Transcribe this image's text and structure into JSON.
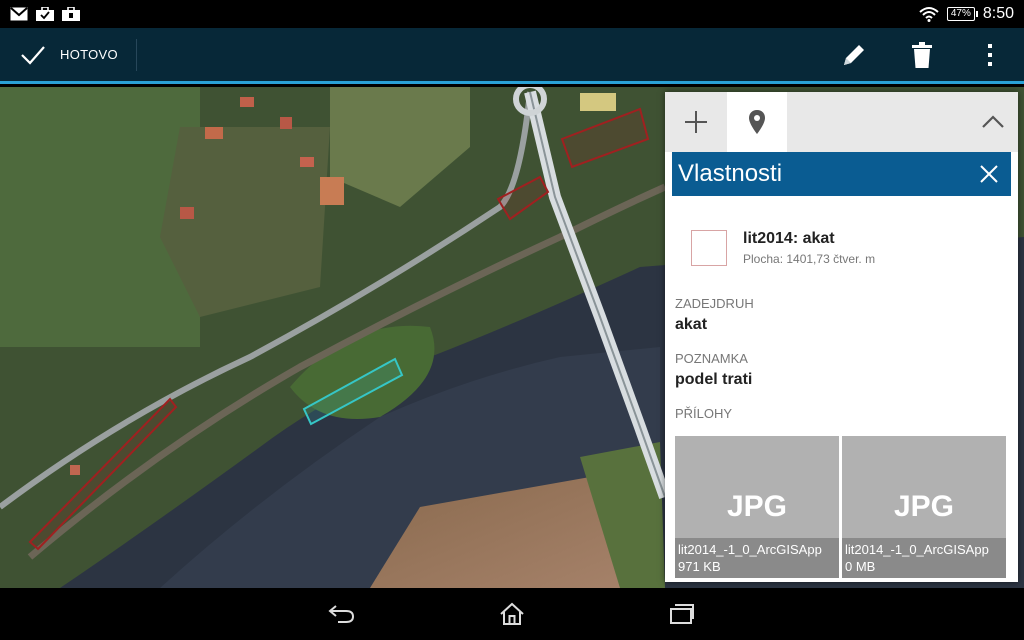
{
  "status_bar": {
    "time": "8:50",
    "battery": "47%",
    "notification_icons": [
      "gmail-icon",
      "briefcase-icon",
      "briefcase-icon"
    ],
    "wifi_icon": "wifi-icon"
  },
  "action_bar": {
    "done_label": "HOTOVO",
    "actions": [
      "pencil-icon",
      "trash-icon",
      "overflow-menu-icon"
    ]
  },
  "panel": {
    "tabs": [
      "add-icon",
      "location-pin-icon"
    ],
    "title": "Vlastnosti",
    "feature": {
      "name": "lit2014: akat",
      "area": "Plocha: 1401,73 čtver. m"
    },
    "fields": [
      {
        "label": "ZADEJDRUH",
        "value": "akat"
      },
      {
        "label": "POZNAMKA",
        "value": "podel trati"
      }
    ],
    "attachments_label": "PŘÍLOHY",
    "attachments": [
      {
        "type": "JPG",
        "name": "lit2014_-1_0_ArcGISApp",
        "size": "971 KB"
      },
      {
        "type": "JPG",
        "name": "lit2014_-1_0_ArcGISApp",
        "size": "0 MB"
      }
    ]
  },
  "map": {
    "polygons": [
      {
        "color": "#36c6c6",
        "role": "selected-feature"
      },
      {
        "color": "#a02020",
        "role": "feature"
      },
      {
        "color": "#a02020",
        "role": "feature"
      },
      {
        "color": "#a02020",
        "role": "feature"
      }
    ]
  },
  "nav_bar": [
    "back-icon",
    "home-icon",
    "recents-icon"
  ],
  "colors": {
    "action_bar": "#072838",
    "accent_line": "#2aa1d6",
    "panel_header": "#0a5c92"
  }
}
